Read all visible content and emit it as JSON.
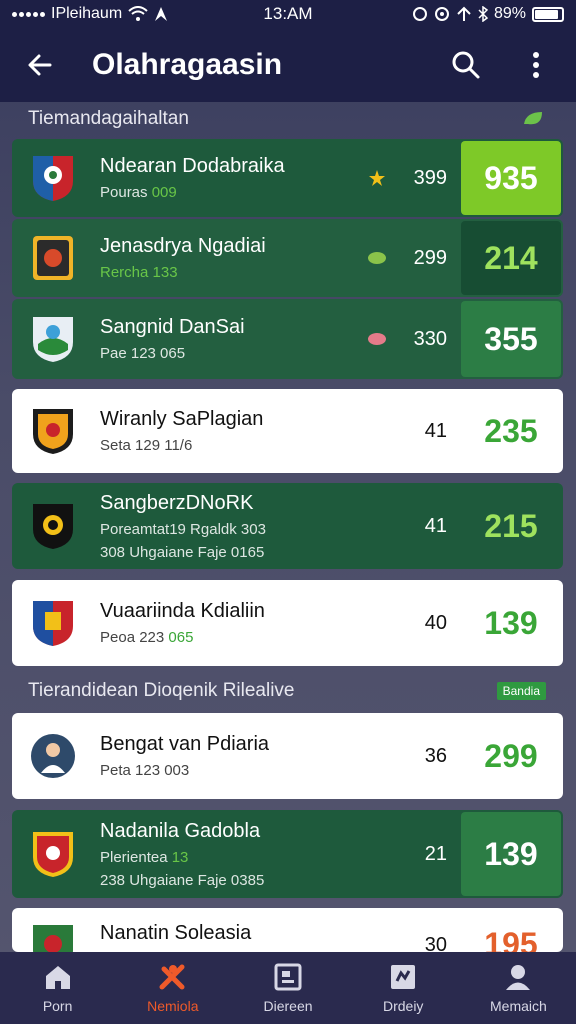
{
  "status": {
    "carrier": "IPleihaum",
    "time": "13:AM",
    "battery": "89%",
    "battery_level": 0.89
  },
  "app_bar": {
    "title": "Olahragaasin",
    "back_icon": "arrow-left-icon",
    "search_icon": "search-icon",
    "menu_icon": "more-vertical-icon"
  },
  "section1": {
    "title": "Tiemandagaihaltan",
    "icon": "leaf-icon",
    "accent": "#6cc24a"
  },
  "section2": {
    "title": "Tierandidean Dioqenik Rilealive",
    "badge": "Bandia"
  },
  "cards": [
    {
      "name": "Ndearan Dodabraika",
      "sub": "Pouras",
      "sub_accent": "009",
      "sub2": "",
      "count": "399",
      "score": "935",
      "mini_icon": "star-icon"
    },
    {
      "name": "Jenasdrya Ngadiai",
      "sub": "",
      "sub_accent": "Rercha 133",
      "sub2": "",
      "count": "299",
      "score": "214",
      "mini_icon": "bud-icon"
    },
    {
      "name": "Sangnid DanSai",
      "sub": "Pae 123 065",
      "sub_accent": "",
      "sub2": "",
      "count": "330",
      "score": "355",
      "mini_icon": "flower-icon"
    },
    {
      "name": "Wiranly SaPlagian",
      "sub": "Seta 129 11/6",
      "sub_accent": "",
      "sub2": "",
      "count": "41",
      "score": "235",
      "mini_icon": ""
    },
    {
      "name": "SangberzDNoRK",
      "sub": "Poreamtat19 Rgaldk 303",
      "sub_accent": "",
      "sub2": "308 Uhgaiane Faje 0165",
      "count": "41",
      "score": "215",
      "mini_icon": ""
    },
    {
      "name": "Vuaariinda Kdialiin",
      "sub": "Peoa 223",
      "sub_accent": "065",
      "sub2": "",
      "count": "40",
      "score": "139",
      "mini_icon": ""
    },
    {
      "name": "Bengat van Pdiaria",
      "sub": "Peta 123 003",
      "sub_accent": "",
      "sub2": "",
      "count": "36",
      "score": "299",
      "mini_icon": ""
    },
    {
      "name": "Nadanila Gadobla",
      "sub": "Plerientea",
      "sub_accent": "13",
      "sub2": "238 Uhgaiane Faje 0385",
      "count": "21",
      "score": "139",
      "mini_icon": ""
    },
    {
      "name": "Nanatin Soleasia",
      "sub": "",
      "sub_accent": "",
      "sub2": "",
      "count": "30",
      "score": "195",
      "mini_icon": ""
    }
  ],
  "tabs": [
    {
      "label": "Porn",
      "icon": "home-icon"
    },
    {
      "label": "Nemiola",
      "icon": "tools-icon"
    },
    {
      "label": "Diereen",
      "icon": "board-icon"
    },
    {
      "label": "Drdeiy",
      "icon": "clipboard-icon"
    },
    {
      "label": "Memaich",
      "icon": "profile-icon"
    }
  ],
  "colors": {
    "header": "#1d1f45",
    "card_green": "#1e5a3c",
    "score_lime": "#7ec928",
    "active_tab": "#ef5a2a"
  }
}
